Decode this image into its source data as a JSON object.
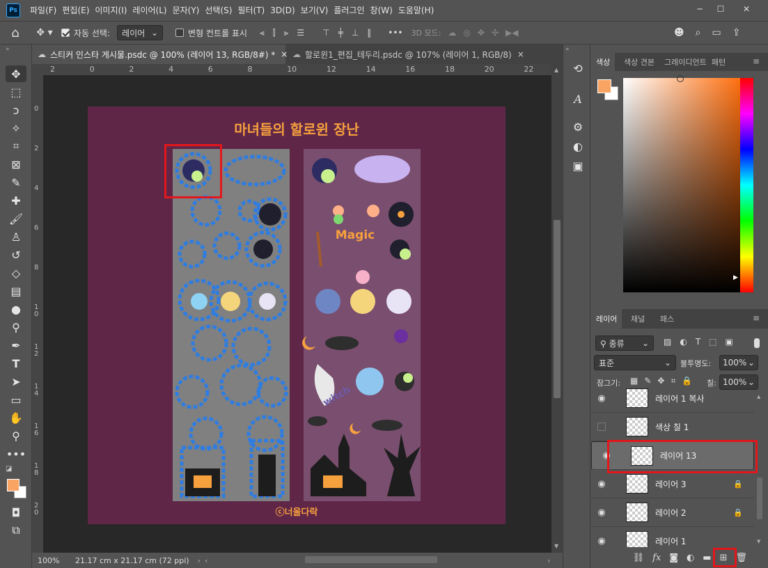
{
  "app": {
    "logo": "Ps"
  },
  "menu": [
    "파일(F)",
    "편집(E)",
    "이미지(I)",
    "레이어(L)",
    "문자(Y)",
    "선택(S)",
    "필터(T)",
    "3D(D)",
    "보기(V)",
    "플러그인",
    "창(W)",
    "도움말(H)"
  ],
  "window_controls": {
    "minimize": "─",
    "maximize": "☐",
    "close": "✕"
  },
  "options": {
    "auto_select_label": "자동 선택:",
    "auto_select_value": "레이어",
    "transform_label": "변형 컨트롤 표시",
    "more": "•••",
    "mode_3d": "3D 모드:"
  },
  "tabs": [
    {
      "label": "스티커 인스타 게시물.psdc @ 100% (레이어 13, RGB/8#) *",
      "close": "×"
    },
    {
      "label": "할로윈1_편집_테두리.psdc @ 107% (레이어 1, RGB/8)",
      "close": "×"
    }
  ],
  "ruler_h": [
    "2",
    "0",
    "2",
    "4",
    "6",
    "8",
    "10",
    "12",
    "14",
    "16",
    "18",
    "20",
    "22"
  ],
  "ruler_v": [
    "0",
    "2",
    "4",
    "6",
    "8",
    "1\n0",
    "1\n2",
    "1\n4",
    "1\n6",
    "1\n8",
    "2\n0"
  ],
  "canvas": {
    "title": "마녀들의 할로윈 장난",
    "signature": "ⓒ너울다락",
    "magic_text": "Magic",
    "witch_text": "witch",
    "bg_color": "#5f2648",
    "title_color": "#f6a03e"
  },
  "status": {
    "zoom": "100%",
    "size": "21.17 cm x 21.17 cm (72 ppi)"
  },
  "color_panel": {
    "tabs": [
      "색상",
      "색상 견본",
      "그레이디언트",
      "패턴"
    ],
    "fg": "#f9a463",
    "bg": "#ffffff"
  },
  "layers_panel": {
    "tabs": [
      "레이어",
      "채널",
      "패스"
    ],
    "filter_label": "종류",
    "blend_mode": "표준",
    "opacity_label": "불투명도:",
    "opacity_value": "100%",
    "lock_label": "잠그기:",
    "fill_label": "칠:",
    "fill_value": "100%",
    "layers": [
      {
        "name": "레이어 1 복사",
        "visible": true,
        "locked": false,
        "selected": false
      },
      {
        "name": "색상 칠 1",
        "visible": false,
        "locked": false,
        "selected": false
      },
      {
        "name": "레이어 13",
        "visible": true,
        "locked": false,
        "selected": true
      },
      {
        "name": "레이어 3",
        "visible": true,
        "locked": true,
        "selected": false
      },
      {
        "name": "레이어 2",
        "visible": true,
        "locked": true,
        "selected": false
      },
      {
        "name": "레이어 1",
        "visible": true,
        "locked": false,
        "selected": false
      }
    ]
  }
}
